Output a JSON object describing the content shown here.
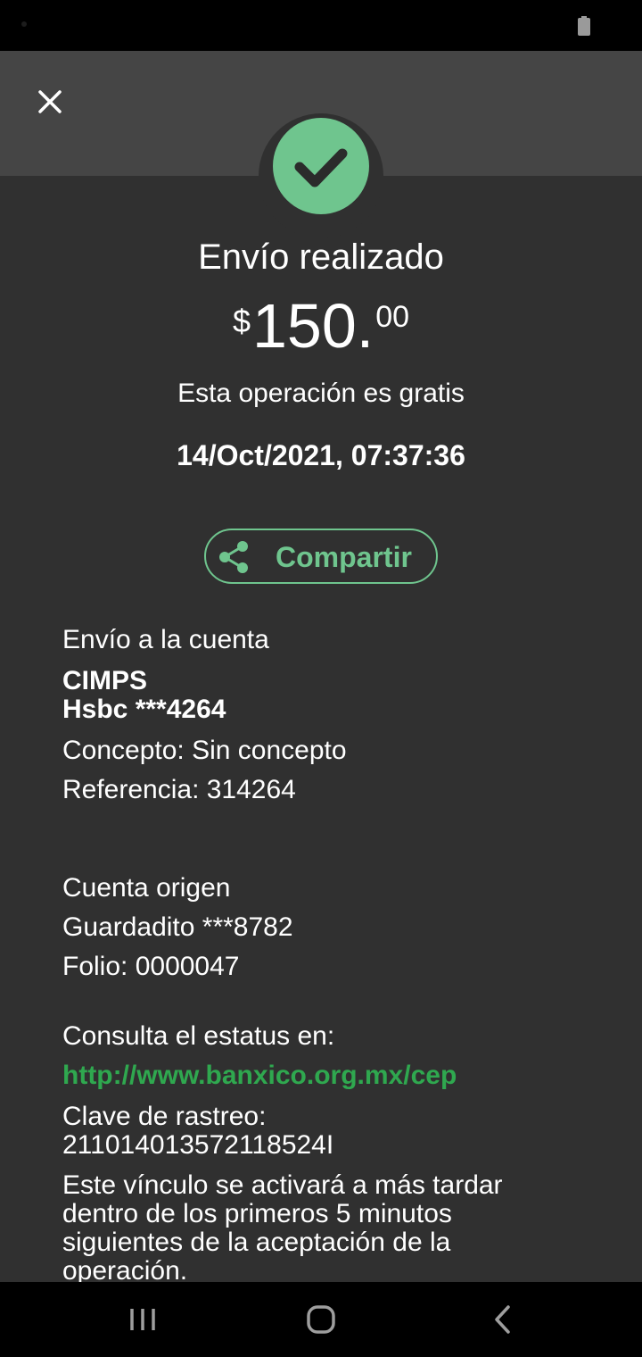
{
  "header": {
    "close_icon": "close-icon"
  },
  "success": {
    "icon": "checkmark-icon",
    "color": "#6fc58e"
  },
  "title": "Envío realizado",
  "amount": {
    "currency": "$",
    "integer": "150.",
    "cents": "00"
  },
  "fee_note": "Esta operación es gratis",
  "datetime": "14/Oct/2021, 07:37:36",
  "share": {
    "label": "Compartir",
    "icon": "share-icon",
    "accent": "#6fc58e"
  },
  "destination": {
    "heading": "Envío a la cuenta",
    "name": "CIMPS",
    "account": "Hsbc ***4264",
    "concept": "Concepto: Sin concepto",
    "reference": "Referencia: 314264"
  },
  "origin": {
    "heading": "Cuenta origen",
    "account": "Guardadito  ***8782",
    "folio": "Folio: 0000047"
  },
  "status": {
    "heading": "Consulta el estatus en:",
    "link": "http://www.banxico.org.mx/cep",
    "tracking_label": "Clave de rastreo:",
    "tracking_key": "21101401357211852 4I",
    "note": "Este vínculo se activará a más tardar dentro de los primeros 5 minutos siguientes de la aceptación de la operación."
  },
  "nav": {
    "recent": "recent-apps-icon",
    "home": "home-icon",
    "back": "back-icon"
  }
}
